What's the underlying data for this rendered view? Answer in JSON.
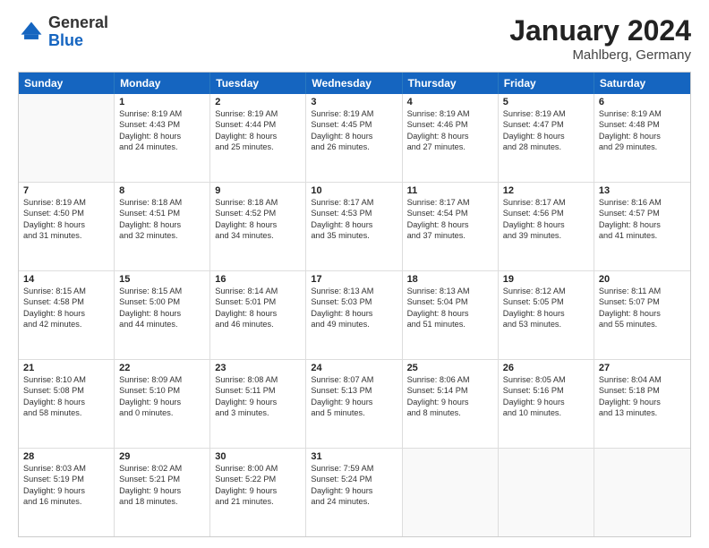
{
  "logo": {
    "general": "General",
    "blue": "Blue"
  },
  "title": {
    "month": "January 2024",
    "location": "Mahlberg, Germany"
  },
  "header_days": [
    "Sunday",
    "Monday",
    "Tuesday",
    "Wednesday",
    "Thursday",
    "Friday",
    "Saturday"
  ],
  "weeks": [
    [
      {
        "day": "",
        "lines": []
      },
      {
        "day": "1",
        "lines": [
          "Sunrise: 8:19 AM",
          "Sunset: 4:43 PM",
          "Daylight: 8 hours",
          "and 24 minutes."
        ]
      },
      {
        "day": "2",
        "lines": [
          "Sunrise: 8:19 AM",
          "Sunset: 4:44 PM",
          "Daylight: 8 hours",
          "and 25 minutes."
        ]
      },
      {
        "day": "3",
        "lines": [
          "Sunrise: 8:19 AM",
          "Sunset: 4:45 PM",
          "Daylight: 8 hours",
          "and 26 minutes."
        ]
      },
      {
        "day": "4",
        "lines": [
          "Sunrise: 8:19 AM",
          "Sunset: 4:46 PM",
          "Daylight: 8 hours",
          "and 27 minutes."
        ]
      },
      {
        "day": "5",
        "lines": [
          "Sunrise: 8:19 AM",
          "Sunset: 4:47 PM",
          "Daylight: 8 hours",
          "and 28 minutes."
        ]
      },
      {
        "day": "6",
        "lines": [
          "Sunrise: 8:19 AM",
          "Sunset: 4:48 PM",
          "Daylight: 8 hours",
          "and 29 minutes."
        ]
      }
    ],
    [
      {
        "day": "7",
        "lines": [
          "Sunrise: 8:19 AM",
          "Sunset: 4:50 PM",
          "Daylight: 8 hours",
          "and 31 minutes."
        ]
      },
      {
        "day": "8",
        "lines": [
          "Sunrise: 8:18 AM",
          "Sunset: 4:51 PM",
          "Daylight: 8 hours",
          "and 32 minutes."
        ]
      },
      {
        "day": "9",
        "lines": [
          "Sunrise: 8:18 AM",
          "Sunset: 4:52 PM",
          "Daylight: 8 hours",
          "and 34 minutes."
        ]
      },
      {
        "day": "10",
        "lines": [
          "Sunrise: 8:17 AM",
          "Sunset: 4:53 PM",
          "Daylight: 8 hours",
          "and 35 minutes."
        ]
      },
      {
        "day": "11",
        "lines": [
          "Sunrise: 8:17 AM",
          "Sunset: 4:54 PM",
          "Daylight: 8 hours",
          "and 37 minutes."
        ]
      },
      {
        "day": "12",
        "lines": [
          "Sunrise: 8:17 AM",
          "Sunset: 4:56 PM",
          "Daylight: 8 hours",
          "and 39 minutes."
        ]
      },
      {
        "day": "13",
        "lines": [
          "Sunrise: 8:16 AM",
          "Sunset: 4:57 PM",
          "Daylight: 8 hours",
          "and 41 minutes."
        ]
      }
    ],
    [
      {
        "day": "14",
        "lines": [
          "Sunrise: 8:15 AM",
          "Sunset: 4:58 PM",
          "Daylight: 8 hours",
          "and 42 minutes."
        ]
      },
      {
        "day": "15",
        "lines": [
          "Sunrise: 8:15 AM",
          "Sunset: 5:00 PM",
          "Daylight: 8 hours",
          "and 44 minutes."
        ]
      },
      {
        "day": "16",
        "lines": [
          "Sunrise: 8:14 AM",
          "Sunset: 5:01 PM",
          "Daylight: 8 hours",
          "and 46 minutes."
        ]
      },
      {
        "day": "17",
        "lines": [
          "Sunrise: 8:13 AM",
          "Sunset: 5:03 PM",
          "Daylight: 8 hours",
          "and 49 minutes."
        ]
      },
      {
        "day": "18",
        "lines": [
          "Sunrise: 8:13 AM",
          "Sunset: 5:04 PM",
          "Daylight: 8 hours",
          "and 51 minutes."
        ]
      },
      {
        "day": "19",
        "lines": [
          "Sunrise: 8:12 AM",
          "Sunset: 5:05 PM",
          "Daylight: 8 hours",
          "and 53 minutes."
        ]
      },
      {
        "day": "20",
        "lines": [
          "Sunrise: 8:11 AM",
          "Sunset: 5:07 PM",
          "Daylight: 8 hours",
          "and 55 minutes."
        ]
      }
    ],
    [
      {
        "day": "21",
        "lines": [
          "Sunrise: 8:10 AM",
          "Sunset: 5:08 PM",
          "Daylight: 8 hours",
          "and 58 minutes."
        ]
      },
      {
        "day": "22",
        "lines": [
          "Sunrise: 8:09 AM",
          "Sunset: 5:10 PM",
          "Daylight: 9 hours",
          "and 0 minutes."
        ]
      },
      {
        "day": "23",
        "lines": [
          "Sunrise: 8:08 AM",
          "Sunset: 5:11 PM",
          "Daylight: 9 hours",
          "and 3 minutes."
        ]
      },
      {
        "day": "24",
        "lines": [
          "Sunrise: 8:07 AM",
          "Sunset: 5:13 PM",
          "Daylight: 9 hours",
          "and 5 minutes."
        ]
      },
      {
        "day": "25",
        "lines": [
          "Sunrise: 8:06 AM",
          "Sunset: 5:14 PM",
          "Daylight: 9 hours",
          "and 8 minutes."
        ]
      },
      {
        "day": "26",
        "lines": [
          "Sunrise: 8:05 AM",
          "Sunset: 5:16 PM",
          "Daylight: 9 hours",
          "and 10 minutes."
        ]
      },
      {
        "day": "27",
        "lines": [
          "Sunrise: 8:04 AM",
          "Sunset: 5:18 PM",
          "Daylight: 9 hours",
          "and 13 minutes."
        ]
      }
    ],
    [
      {
        "day": "28",
        "lines": [
          "Sunrise: 8:03 AM",
          "Sunset: 5:19 PM",
          "Daylight: 9 hours",
          "and 16 minutes."
        ]
      },
      {
        "day": "29",
        "lines": [
          "Sunrise: 8:02 AM",
          "Sunset: 5:21 PM",
          "Daylight: 9 hours",
          "and 18 minutes."
        ]
      },
      {
        "day": "30",
        "lines": [
          "Sunrise: 8:00 AM",
          "Sunset: 5:22 PM",
          "Daylight: 9 hours",
          "and 21 minutes."
        ]
      },
      {
        "day": "31",
        "lines": [
          "Sunrise: 7:59 AM",
          "Sunset: 5:24 PM",
          "Daylight: 9 hours",
          "and 24 minutes."
        ]
      },
      {
        "day": "",
        "lines": []
      },
      {
        "day": "",
        "lines": []
      },
      {
        "day": "",
        "lines": []
      }
    ]
  ]
}
